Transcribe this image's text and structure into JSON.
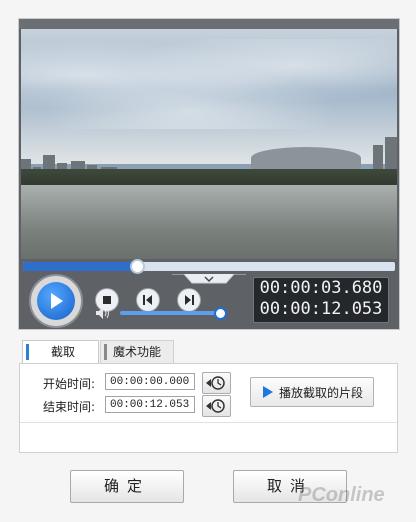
{
  "player": {
    "current_time": "00:00:03.680",
    "total_time": "00:00:12.053",
    "progress": 0.306,
    "volume": 0.95
  },
  "tabs": [
    {
      "label": "截取",
      "active": true
    },
    {
      "label": "魔术功能",
      "active": false
    }
  ],
  "clip": {
    "start_label": "开始时间:",
    "start_value": "00:00:00.000",
    "end_label": "结束时间:",
    "end_value": "00:00:12.053",
    "play_clip_label": "播放截取的片段"
  },
  "buttons": {
    "ok": "确定",
    "cancel": "取消"
  },
  "watermark": "PConline",
  "colors": {
    "accent": "#2f6fcb",
    "play_button": "#1e78e0"
  },
  "icons": [
    "play-icon",
    "stop-icon",
    "previous-frame-icon",
    "next-frame-icon",
    "volume-icon",
    "chevron-down-icon",
    "set-time-icon"
  ]
}
